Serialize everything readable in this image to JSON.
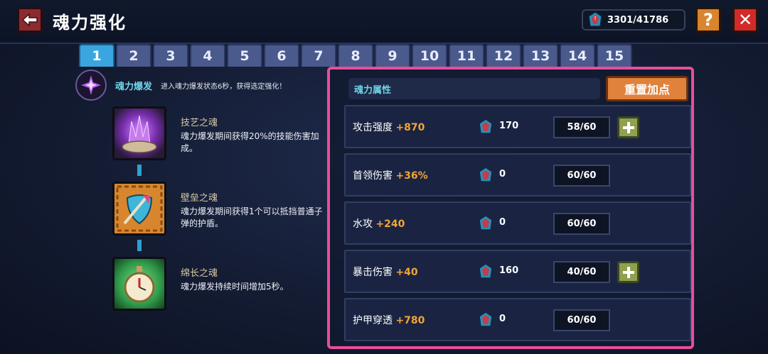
{
  "header": {
    "title": "魂力强化",
    "currency": "3301/41786",
    "help_label": "?",
    "close_label": "✕"
  },
  "tabs": [
    "1",
    "2",
    "3",
    "4",
    "5",
    "6",
    "7",
    "8",
    "9",
    "10",
    "11",
    "12",
    "13",
    "14",
    "15"
  ],
  "active_tab": "1",
  "burst": {
    "title": "魂力爆发",
    "desc": "进入魂力爆发状态6秒，获得选定强化！"
  },
  "skills": [
    {
      "name": "技艺之魂",
      "desc": "魂力爆发期间获得20%的技能伤害加成。",
      "icon": "purple-crystal-icon"
    },
    {
      "name": "壁垒之魂",
      "desc": "魂力爆发期间获得1个可以抵挡普通子弹的护盾。",
      "icon": "shield-sword-icon"
    },
    {
      "name": "绵长之魂",
      "desc": "魂力爆发持续时间增加5秒。",
      "icon": "stopwatch-icon"
    }
  ],
  "attributes": {
    "header": "魂力属性",
    "reset_label": "重置加点",
    "rows": [
      {
        "name": "攻击强度",
        "bonus": "+870",
        "cost": "170",
        "level": "58/60",
        "can_add": true
      },
      {
        "name": "首领伤害",
        "bonus": "+36%",
        "cost": "0",
        "level": "60/60",
        "can_add": false
      },
      {
        "name": "水攻",
        "bonus": "+240",
        "cost": "0",
        "level": "60/60",
        "can_add": false
      },
      {
        "name": "暴击伤害",
        "bonus": "+40",
        "cost": "160",
        "level": "40/60",
        "can_add": true
      },
      {
        "name": "护甲穿透",
        "bonus": "+780",
        "cost": "0",
        "level": "60/60",
        "can_add": false
      }
    ]
  },
  "colors": {
    "accent": "#3aa6e0",
    "bonus": "#f2a437",
    "highlight_border": "#e84e9a",
    "reset_button": "#e0823c"
  }
}
